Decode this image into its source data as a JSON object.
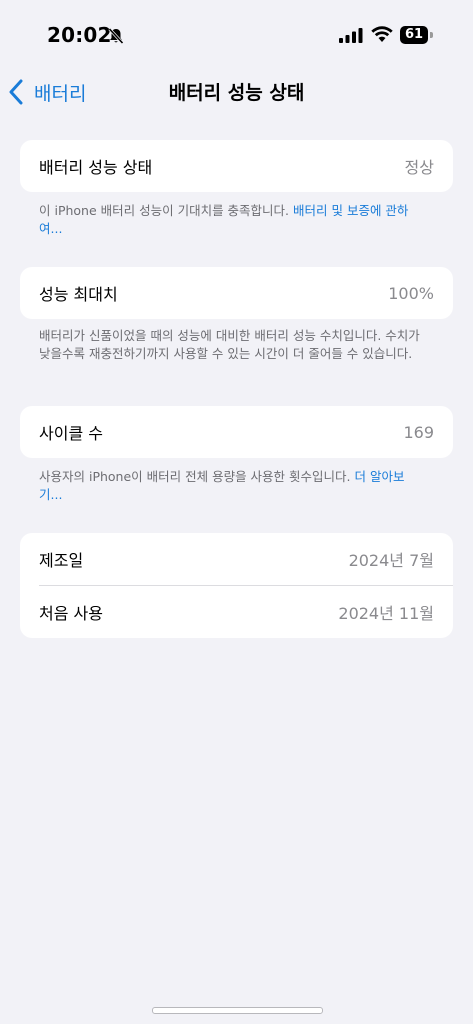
{
  "status_bar": {
    "time": "20:02",
    "battery_level": "61",
    "icons": [
      "bell-slash-icon",
      "cellular-signal-icon",
      "wifi-icon",
      "battery-icon"
    ]
  },
  "nav": {
    "back_label": "배터리",
    "title": "배터리 성능 상태"
  },
  "health_group": {
    "label": "배터리 성능 상태",
    "value": "정상"
  },
  "health_footnote": {
    "text": "이 iPhone 배터리 성능이 기대치를 충족합니다. ",
    "link": "배터리 및 보증에 관하여..."
  },
  "capacity_group": {
    "label": "성능 최대치",
    "value": "100%"
  },
  "capacity_footnote": {
    "text": "배터리가 신품이었을 때의 성능에 대비한 배터리 성능 수치입니다. 수치가 낮을수록 재충전하기까지 사용할 수 있는 시간이 더 줄어들 수 있습니다."
  },
  "cycle_group": {
    "label": "사이클 수",
    "value": "169"
  },
  "cycle_footnote": {
    "text": "사용자의 iPhone이 배터리 전체 용량을 사용한 횟수입니다. ",
    "link": "더 알아보기..."
  },
  "dates_group": {
    "manufacture_label": "제조일",
    "manufacture_value": "2024년 7월",
    "first_use_label": "처음 사용",
    "first_use_value": "2024년 11월"
  },
  "colors": {
    "accent": "#1a7cd8",
    "background": "#f2f2f7",
    "secondary_text": "#8a8a8e"
  }
}
